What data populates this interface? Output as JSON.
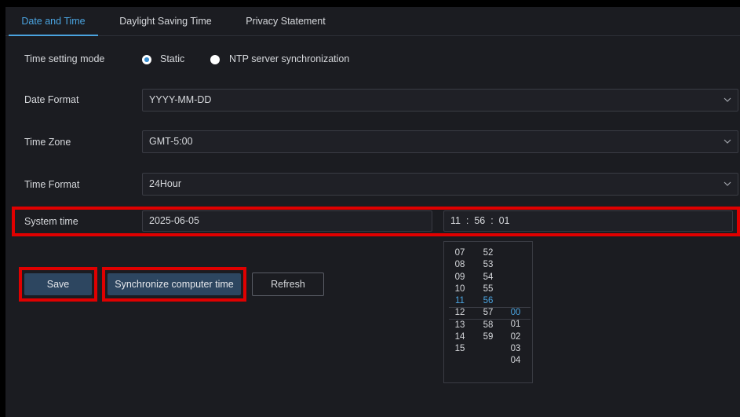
{
  "tabs": [
    {
      "label": "Date and Time",
      "active": true
    },
    {
      "label": "Daylight Saving Time",
      "active": false
    },
    {
      "label": "Privacy Statement",
      "active": false
    }
  ],
  "time_setting_mode": {
    "label": "Time setting mode",
    "options": [
      {
        "label": "Static",
        "checked": true
      },
      {
        "label": "NTP server synchronization",
        "checked": false
      }
    ]
  },
  "date_format": {
    "label": "Date Format",
    "value": "YYYY-MM-DD",
    "icon": "chevron-down-icon"
  },
  "time_zone": {
    "label": "Time Zone",
    "value": "GMT-5:00",
    "icon": "chevron-down-icon"
  },
  "time_format": {
    "label": "Time Format",
    "value": "24Hour",
    "icon": "chevron-down-icon"
  },
  "system_time": {
    "label": "System time",
    "date": "2025-06-05",
    "time": "11  :  56  :  01"
  },
  "buttons": {
    "save": "Save",
    "sync": "Synchronize computer time",
    "refresh": "Refresh"
  },
  "time_picker": {
    "hours": [
      "07",
      "08",
      "09",
      "10",
      "11",
      "12",
      "13",
      "14",
      "15"
    ],
    "minutes": [
      "52",
      "53",
      "54",
      "55",
      "56",
      "57",
      "58",
      "59"
    ],
    "seconds": [
      "00",
      "01",
      "02",
      "03",
      "04"
    ],
    "selected_hour": "11",
    "selected_minute": "56",
    "selected_second": "00"
  },
  "colors": {
    "accent": "#4aa3df",
    "highlight_box": "#e00000",
    "background": "#1b1c21"
  }
}
